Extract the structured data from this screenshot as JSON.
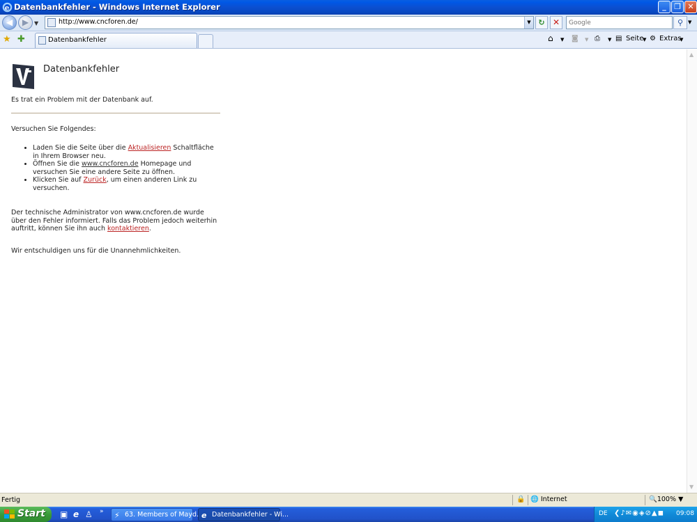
{
  "window": {
    "title": "Datenbankfehler - Windows Internet Explorer",
    "minimize": "_",
    "maximize": "❐",
    "close": "✕"
  },
  "toolbar": {
    "url": "http://www.cncforen.de/",
    "search_placeholder": "Google",
    "tab_label": "Datenbankfehler",
    "cmd_seite": "Seite",
    "cmd_extras": "Extras"
  },
  "page": {
    "heading": "Datenbankfehler",
    "intro": "Es trat ein Problem mit der Datenbank auf.",
    "try_label": "Versuchen Sie Folgendes:",
    "tip1_a": "Laden Sie die Seite über die ",
    "tip1_link": "Aktualisieren",
    "tip1_b": " Schaltfläche in Ihrem Browser neu.",
    "tip2_a": "Öffnen Sie die ",
    "tip2_link": "www.cncforen.de",
    "tip2_b": " Homepage und versuchen Sie eine andere Seite zu öffnen.",
    "tip3_a": "Klicken Sie auf ",
    "tip3_link": "Zurück",
    "tip3_b": ", um einen anderen Link zu versuchen.",
    "admin_a": "Der technische Administrator von www.cncforen.de wurde über den Fehler informiert. Falls das Problem jedoch weiterhin auftritt, können Sie ihn auch ",
    "admin_link": "kontaktieren",
    "admin_b": ".",
    "apology": "Wir entschuldigen uns für die Unannehmlichkeiten."
  },
  "status": {
    "text": "Fertig",
    "zone": "Internet",
    "zoom": "100%"
  },
  "taskbar": {
    "start": "Start",
    "task1": "63. Members of Mayd...",
    "task2": "Datenbankfehler - Wi...",
    "lang": "DE",
    "clock": "09:08"
  },
  "colors": {
    "link": "#bb2222",
    "title_bar": "#0b4fd0",
    "taskbar": "#245edb",
    "start": "#3a9a3a"
  }
}
